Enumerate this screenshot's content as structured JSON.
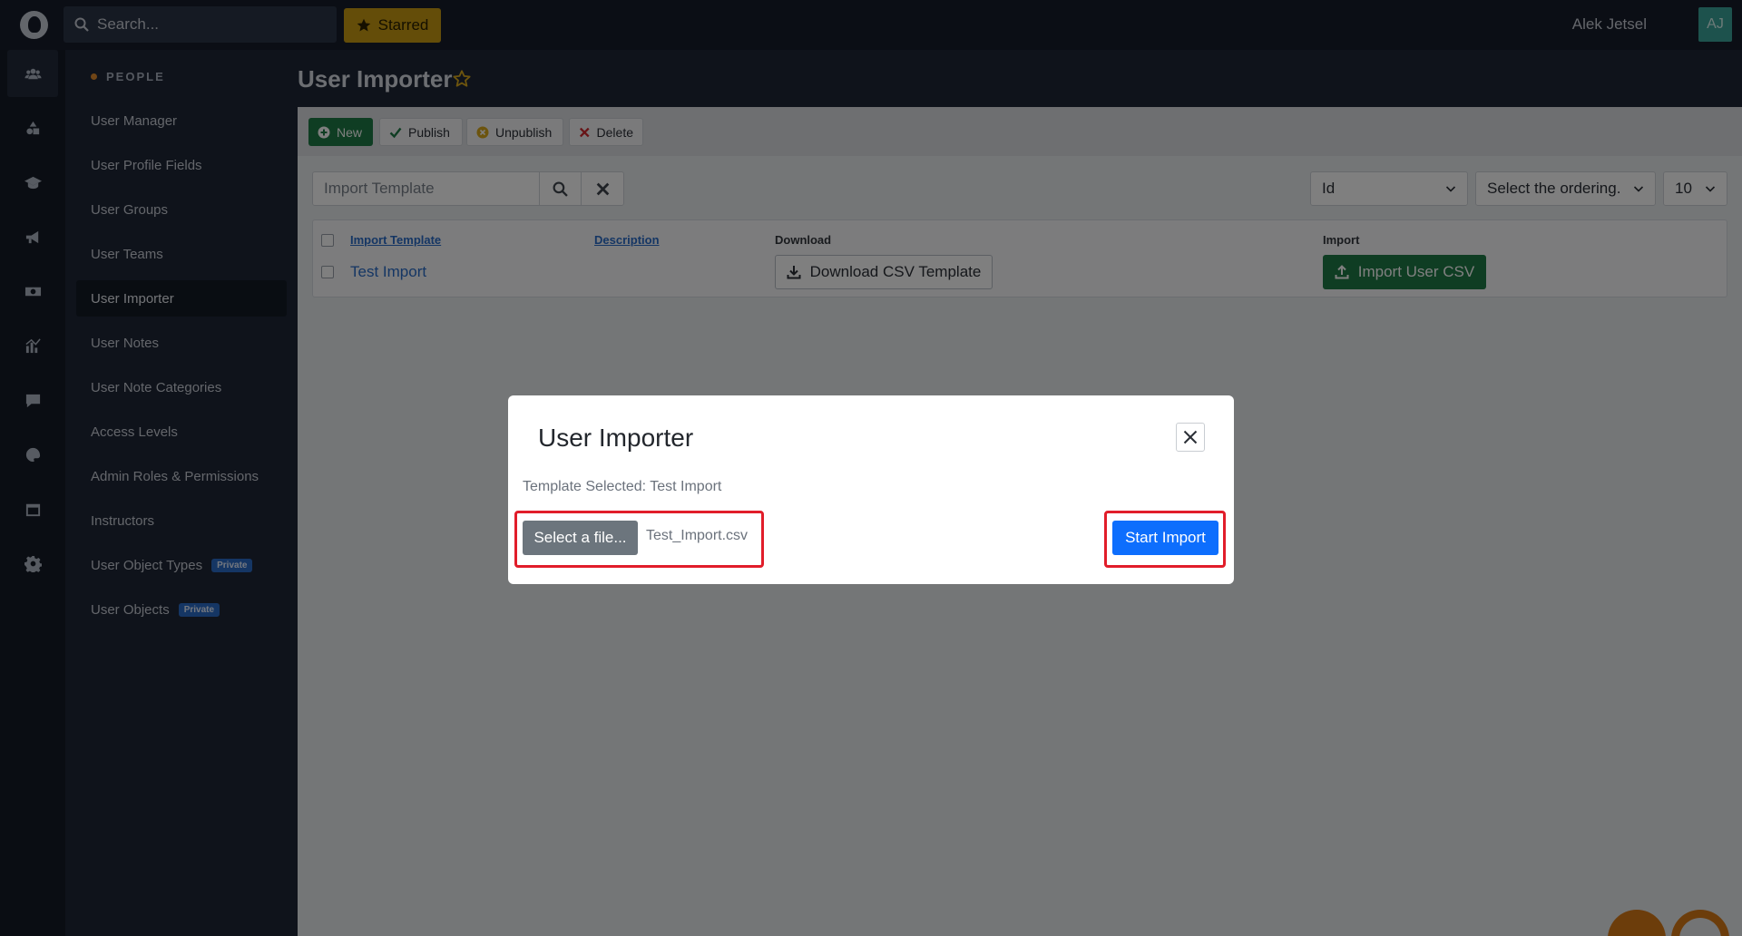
{
  "topbar": {
    "search_placeholder": "Search...",
    "starred_label": "Starred",
    "user_name": "Alek Jetsel",
    "avatar_initials": "AJ"
  },
  "rail": {
    "icons": [
      "users-icon",
      "shapes-icon",
      "graduation-cap-icon",
      "megaphone-icon",
      "money-icon",
      "chart-icon",
      "comment-icon",
      "palette-icon",
      "calendar-icon",
      "gear-icon"
    ]
  },
  "sidebar": {
    "section": "PEOPLE",
    "items": [
      {
        "label": "User Manager"
      },
      {
        "label": "User Profile Fields"
      },
      {
        "label": "User Groups"
      },
      {
        "label": "User Teams"
      },
      {
        "label": "User Importer",
        "active": true
      },
      {
        "label": "User Notes"
      },
      {
        "label": "User Note Categories"
      },
      {
        "label": "Access Levels"
      },
      {
        "label": "Admin Roles & Permissions"
      },
      {
        "label": "Instructors"
      },
      {
        "label": "User Object Types",
        "badge": "Private"
      },
      {
        "label": "User Objects",
        "badge": "Private"
      }
    ]
  },
  "page": {
    "title": "User Importer"
  },
  "toolbar": {
    "new_label": "New",
    "publish_label": "Publish",
    "unpublish_label": "Unpublish",
    "delete_label": "Delete"
  },
  "filters": {
    "search_placeholder": "Import Template",
    "sort_field": "Id",
    "ordering": "Select the ordering.",
    "limit": "10"
  },
  "table": {
    "headers": [
      "Import Template",
      "Description",
      "Download",
      "Import"
    ],
    "rows": [
      {
        "template": "Test Import",
        "description": "",
        "download_label": "Download CSV Template",
        "import_label": "Import User CSV"
      }
    ]
  },
  "modal": {
    "title": "User Importer",
    "template_selected": "Template Selected: Test Import",
    "file_button": "Select a file...",
    "file_name": "Test_Import.csv",
    "start_button": "Start Import"
  },
  "colors": {
    "highlight": "#e11d2a",
    "primary": "#0d6efd",
    "success": "#1f7a46",
    "starred": "#c99a12"
  }
}
